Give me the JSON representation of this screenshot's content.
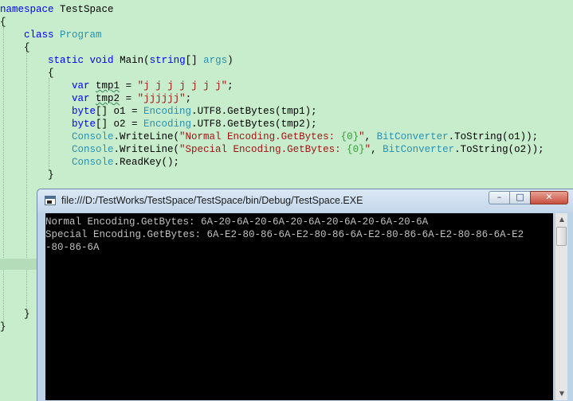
{
  "code": {
    "l1": {
      "kw": "namespace",
      "rest": " TestSpace"
    },
    "l2": {
      "text": "{"
    },
    "l3": {
      "kw": "class",
      "ty": "Program"
    },
    "l4": {
      "text": "{"
    },
    "l5": {
      "kw1": "static",
      "kw2": "void",
      "name": "Main(",
      "kw3": "string",
      "br": "[] ",
      "arg": "args",
      "close": ")"
    },
    "l6": {
      "text": "{"
    },
    "l7": {
      "kw": "var",
      "var": "tmp1",
      "eq": " = ",
      "str": "\"j j j j j j j\"",
      "semi": ";"
    },
    "l8": {
      "kw": "var",
      "var": "tmp2",
      "eq": " = ",
      "str": "\"jjjjjj\"",
      "semi": ";"
    },
    "l9": {
      "kw": "byte",
      "rest1": "[] o1 = ",
      "ty": "Encoding",
      "rest2": ".UTF8.GetBytes(tmp1);"
    },
    "l10": {
      "kw": "byte",
      "rest1": "[] o2 = ",
      "ty": "Encoding",
      "rest2": ".UTF8.GetBytes(tmp2);"
    },
    "l11": {
      "ty": "Console",
      "m": ".WriteLine(",
      "s1": "\"Normal Encoding.GetBytes: ",
      "f": "{0}",
      "s2": "\"",
      "c": ", ",
      "ty2": "BitConverter",
      "rest": ".ToString(o1));"
    },
    "l12": {
      "ty": "Console",
      "m": ".WriteLine(",
      "s1": "\"Special Encoding.GetBytes: ",
      "f": "{0}",
      "s2": "\"",
      "c": ", ",
      "ty2": "BitConverter",
      "rest": ".ToString(o2));"
    },
    "l13": {
      "ty": "Console",
      "rest": ".ReadKey();"
    },
    "l14": {
      "text": "}"
    },
    "l15": {
      "text": "}"
    },
    "l16": {
      "text": "}"
    }
  },
  "console": {
    "title": "file:///D:/TestWorks/TestSpace/TestSpace/bin/Debug/TestSpace.EXE",
    "minimize": "–",
    "maximize": "□",
    "close": "✕",
    "lines": [
      "Normal Encoding.GetBytes: 6A-20-6A-20-6A-20-6A-20-6A-20-6A-20-6A",
      "Special Encoding.GetBytes: 6A-E2-80-86-6A-E2-80-86-6A-E2-80-86-6A-E2-80-86-6A-E2",
      "-80-86-6A"
    ],
    "scroll_up": "▲",
    "scroll_down": "▼"
  }
}
